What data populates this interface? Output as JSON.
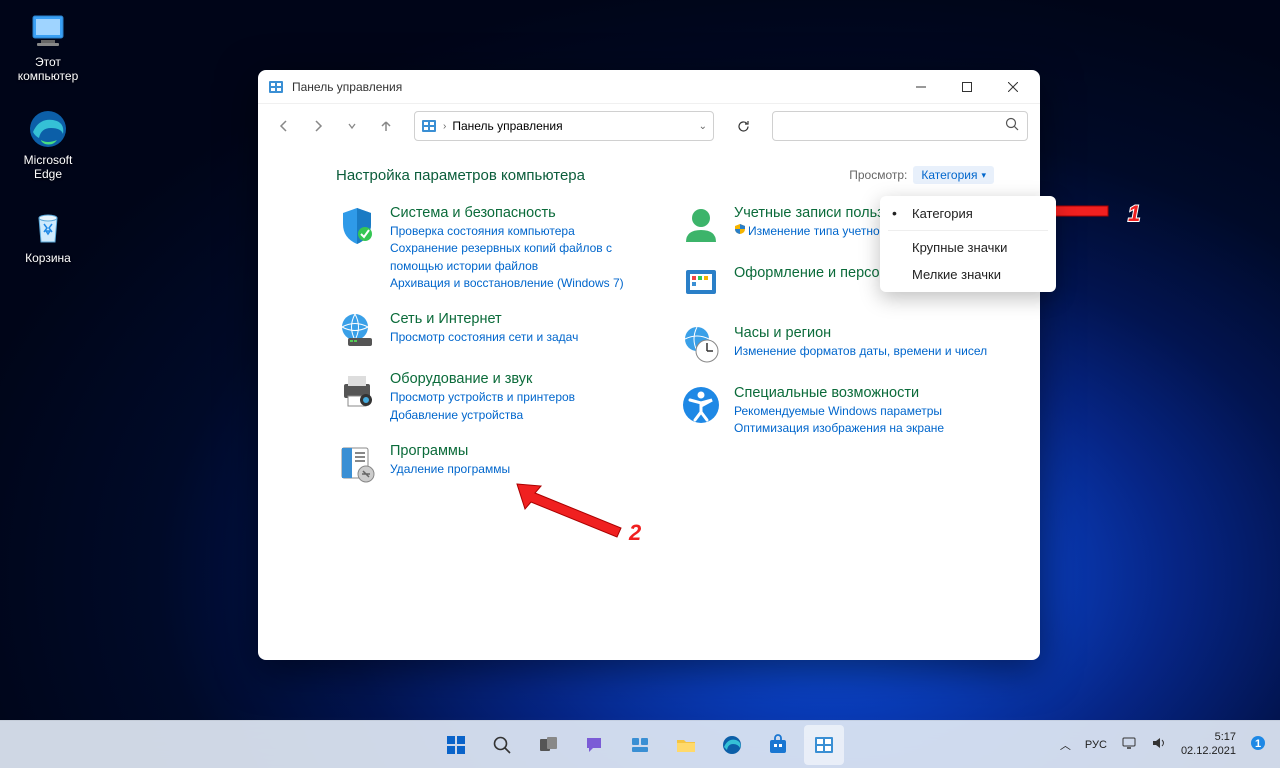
{
  "desktop": {
    "icons": [
      {
        "name": "this-pc",
        "label": "Этот\nкомпьютер"
      },
      {
        "name": "edge",
        "label": "Microsoft\nEdge"
      },
      {
        "name": "recycle-bin",
        "label": "Корзина"
      }
    ]
  },
  "window": {
    "title": "Панель управления",
    "breadcrumb": "Панель управления"
  },
  "content": {
    "heading": "Настройка параметров компьютера",
    "view_label": "Просмотр:",
    "view_value": "Категория"
  },
  "categories": {
    "left": [
      {
        "title": "Система и безопасность",
        "links": [
          "Проверка состояния компьютера",
          "Сохранение резервных копий файлов с помощью истории файлов",
          "Архивация и восстановление (Windows 7)"
        ]
      },
      {
        "title": "Сеть и Интернет",
        "links": [
          "Просмотр состояния сети и задач"
        ]
      },
      {
        "title": "Оборудование и звук",
        "links": [
          "Просмотр устройств и принтеров",
          "Добавление устройства"
        ]
      },
      {
        "title": "Программы",
        "links": [
          "Удаление программы"
        ]
      }
    ],
    "right": [
      {
        "title": "Учетные записи пользователей",
        "links": [
          "Изменение типа учетной записи"
        ],
        "shield": true
      },
      {
        "title": "Оформление и персонализация",
        "links": []
      },
      {
        "title": "Часы и регион",
        "links": [
          "Изменение форматов даты, времени и чисел"
        ]
      },
      {
        "title": "Специальные возможности",
        "links": [
          "Рекомендуемые Windows параметры",
          "Оптимизация изображения на экране"
        ]
      }
    ]
  },
  "view_menu": {
    "items": [
      "Категория",
      "Крупные значки",
      "Мелкие значки"
    ],
    "selected": 0
  },
  "annotations": {
    "tag1": "1",
    "tag2": "2"
  },
  "tray": {
    "lang1": "РУС",
    "time": "5:17",
    "date": "02.12.2021"
  }
}
